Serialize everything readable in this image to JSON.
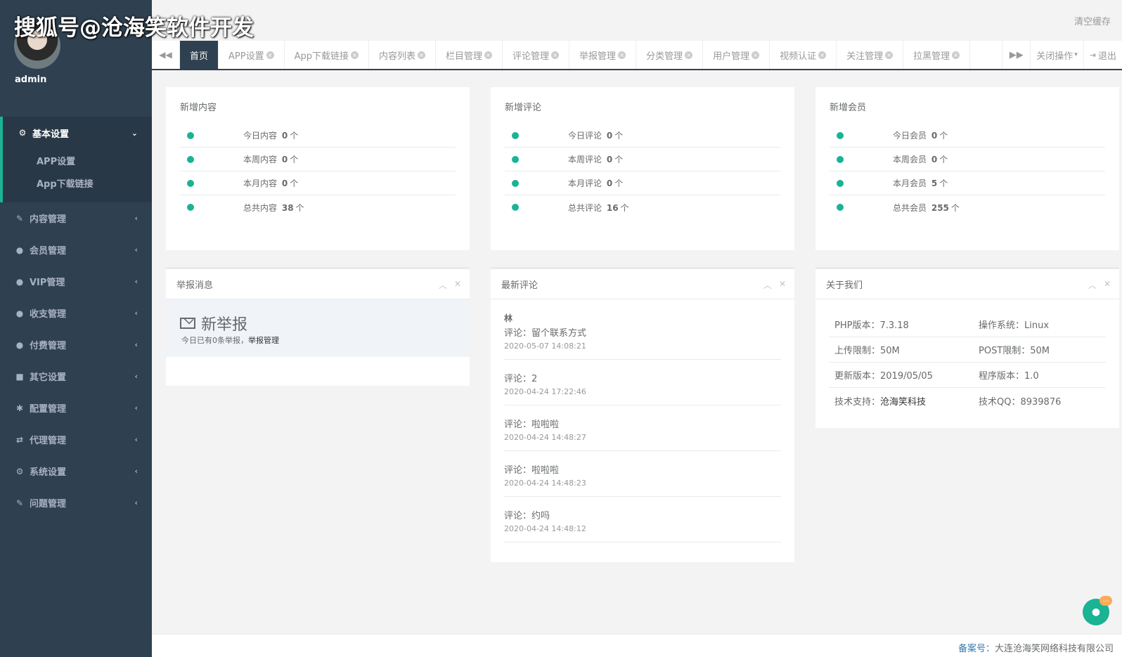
{
  "watermark": "搜狐号@沧海笑软件开发",
  "user": {
    "name": "admin"
  },
  "sidebar": {
    "active_group": {
      "label": "基本设置",
      "icon": "gear-icon",
      "children": [
        "APP设置",
        "App下载链接"
      ]
    },
    "items": [
      {
        "label": "内容管理",
        "icon": "edit-icon"
      },
      {
        "label": "会员管理",
        "icon": "user-icon"
      },
      {
        "label": "VIP管理",
        "icon": "user-icon"
      },
      {
        "label": "收支管理",
        "icon": "user-icon"
      },
      {
        "label": "付费管理",
        "icon": "user-icon"
      },
      {
        "label": "其它设置",
        "icon": "book-icon"
      },
      {
        "label": "配置管理",
        "icon": "asterisk-icon"
      },
      {
        "label": "代理管理",
        "icon": "exchange-icon"
      },
      {
        "label": "系统设置",
        "icon": "cogs-icon"
      },
      {
        "label": "问题管理",
        "icon": "edit-icon"
      }
    ]
  },
  "topbar": {
    "clear_cache": "清空缓存"
  },
  "tabs": {
    "items": [
      "首页",
      "APP设置",
      "App下载链接",
      "内容列表",
      "栏目管理",
      "评论管理",
      "举报管理",
      "分类管理",
      "用户管理",
      "视频认证",
      "关注管理",
      "拉黑管理"
    ],
    "active_index": 0,
    "close_ops": "关闭操作",
    "logout": "退出"
  },
  "stats": [
    {
      "title": "新增内容",
      "rows": [
        {
          "label": "今日内容",
          "value": "0",
          "unit": "个"
        },
        {
          "label": "本周内容",
          "value": "0",
          "unit": "个"
        },
        {
          "label": "本月内容",
          "value": "0",
          "unit": "个"
        },
        {
          "label": "总共内容",
          "value": "38",
          "unit": "个"
        }
      ]
    },
    {
      "title": "新增评论",
      "rows": [
        {
          "label": "今日评论",
          "value": "0",
          "unit": "个"
        },
        {
          "label": "本周评论",
          "value": "0",
          "unit": "个"
        },
        {
          "label": "本月评论",
          "value": "0",
          "unit": "个"
        },
        {
          "label": "总共评论",
          "value": "16",
          "unit": "个"
        }
      ]
    },
    {
      "title": "新增会员",
      "rows": [
        {
          "label": "今日会员",
          "value": "0",
          "unit": "个"
        },
        {
          "label": "本周会员",
          "value": "0",
          "unit": "个"
        },
        {
          "label": "本月会员",
          "value": "5",
          "unit": "个"
        },
        {
          "label": "总共会员",
          "value": "255",
          "unit": "个"
        }
      ]
    }
  ],
  "report": {
    "title": "举报消息",
    "headline": "新举报",
    "sub_prefix": "今日已有0条举报，",
    "sub_link": "举报管理"
  },
  "comments": {
    "title": "最新评论",
    "items": [
      {
        "user": "林",
        "text": "评论：留个联系方式",
        "time": "2020-05-07 14:08:21"
      },
      {
        "user": "",
        "text": "评论：2",
        "time": "2020-04-24 17:22:46"
      },
      {
        "user": "",
        "text": "评论：啦啦啦",
        "time": "2020-04-24 14:48:27"
      },
      {
        "user": "",
        "text": "评论：啦啦啦",
        "time": "2020-04-24 14:48:23"
      },
      {
        "user": "",
        "text": "评论：约吗",
        "time": "2020-04-24 14:48:12"
      }
    ]
  },
  "about": {
    "title": "关于我们",
    "rows": [
      {
        "k1": "PHP版本：",
        "v1": "7.3.18",
        "k2": "操作系统：",
        "v2": "Linux"
      },
      {
        "k1": "上传限制：",
        "v1": "50M",
        "k2": "POST限制：",
        "v2": "50M"
      },
      {
        "k1": "更新版本：",
        "v1": "2019/05/05",
        "k2": "程序版本：",
        "v2": "1.0"
      },
      {
        "k1": "技术支持：",
        "v1": "沧海笑科技",
        "k2": "技术QQ：",
        "v2": "8939876"
      }
    ]
  },
  "footer": {
    "label": "备案号：",
    "text": "大连沧海笑网络科技有限公司"
  },
  "chat": {
    "badge": "…"
  },
  "colors": {
    "sidebar": "#2f4050",
    "accent": "#1ab394",
    "background": "#f3f3f4"
  }
}
